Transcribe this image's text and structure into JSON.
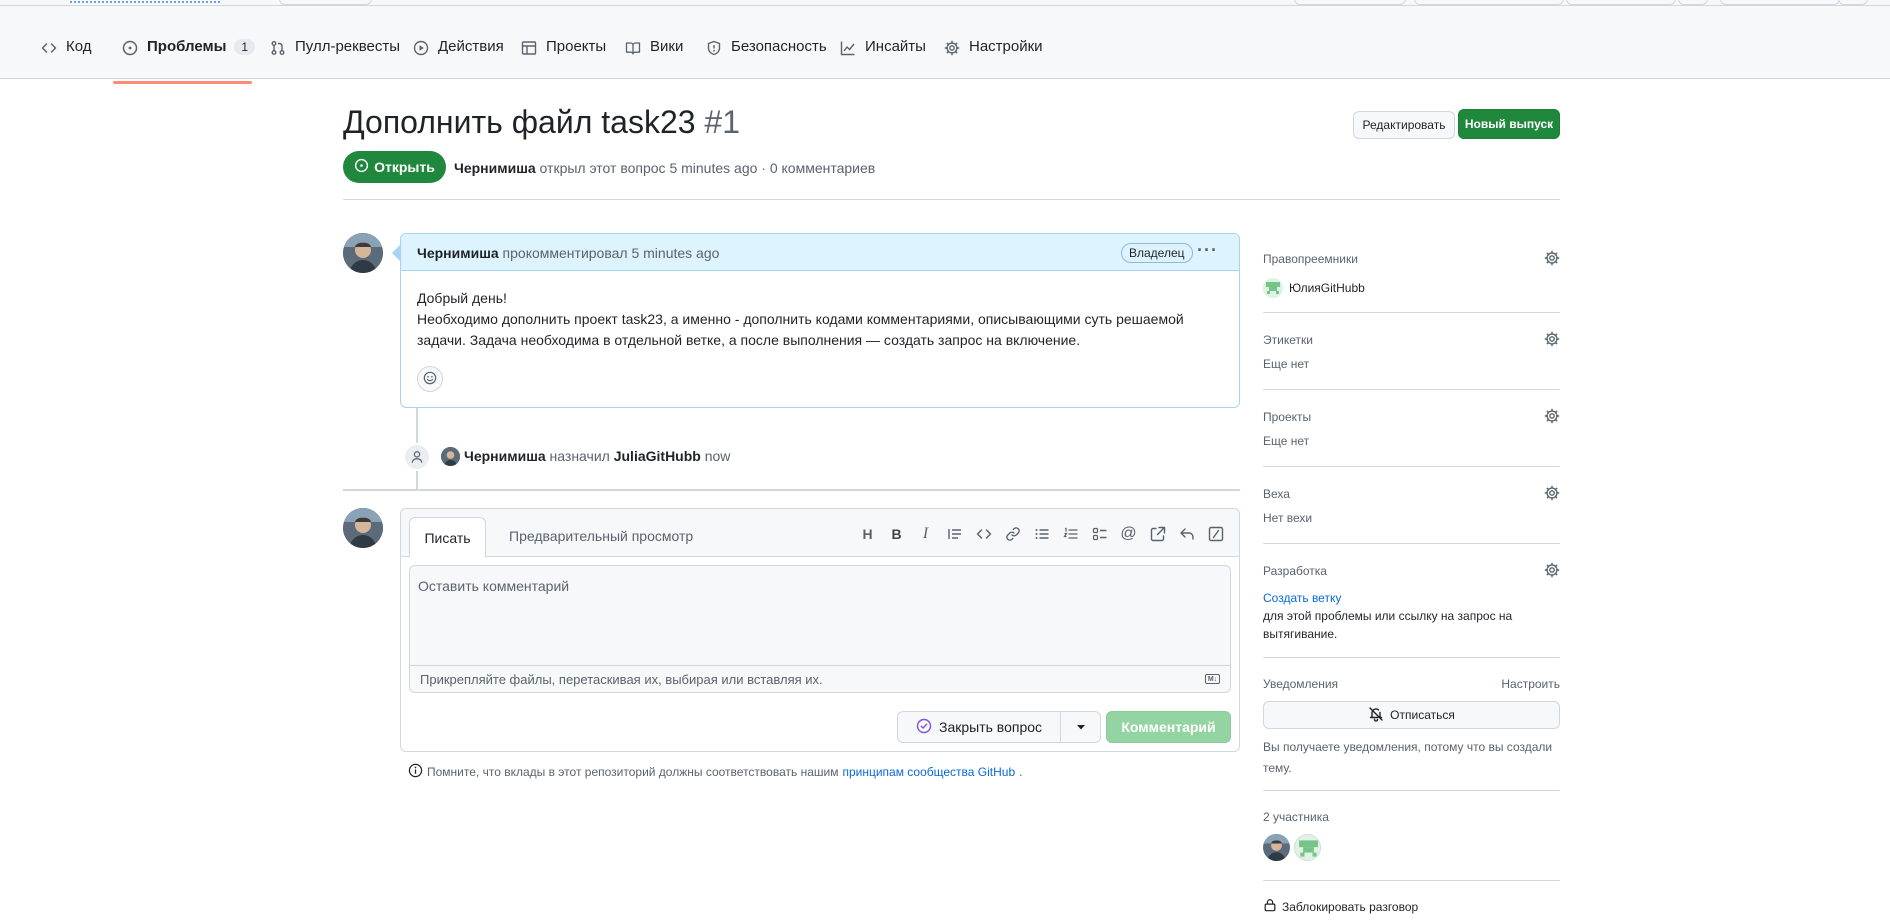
{
  "nav": {
    "tabs": [
      {
        "label": "Код",
        "icon": "code-icon"
      },
      {
        "label": "Проблемы",
        "icon": "issue-opened-icon",
        "count": "1"
      },
      {
        "label": "Пулл-реквесты",
        "icon": "git-pull-request-icon"
      },
      {
        "label": "Действия",
        "icon": "play-icon"
      },
      {
        "label": "Проекты",
        "icon": "table-icon"
      },
      {
        "label": "Вики",
        "icon": "book-icon"
      },
      {
        "label": "Безопасность",
        "icon": "shield-icon"
      },
      {
        "label": "Инсайты",
        "icon": "graph-icon"
      },
      {
        "label": "Настройки",
        "icon": "gear-icon"
      }
    ],
    "active": "Проблемы"
  },
  "issue": {
    "title": "Дополнить файл task23",
    "number": "#1",
    "state": "Открыть",
    "author": "Чернимиша",
    "meta_text": "открыл этот вопрос 5 minutes ago · 0 комментариев",
    "edit_label": "Редактировать",
    "new_label": "Новый выпуск"
  },
  "comment": {
    "author": "Чернимиша",
    "action": "прокомментировал 5 minutes ago",
    "badge": "Владелец",
    "body_line1": "Добрый день!",
    "body_line2": "Необходимо дополнить проект task23, а именно - дополнить кодами комментариями, описывающими суть решаемой задачи. Задача необходима в отдельной ветке, а после выполнения — создать запрос на включение."
  },
  "event": {
    "actor": "Чернимиша",
    "action": "назначил",
    "target": "JuliaGitHubb",
    "time": "now"
  },
  "editor": {
    "tab_write": "Писать",
    "tab_preview": "Предварительный просмотр",
    "placeholder": "Оставить комментарий",
    "attach_hint": "Прикрепляйте файлы, перетаскивая их, выбирая или вставляя их.",
    "close_label": "Закрыть вопрос",
    "comment_label": "Комментарий",
    "tools": [
      "heading-icon",
      "bold-icon",
      "italic-icon",
      "quote-icon",
      "code-icon",
      "link-icon",
      "unordered-list-icon",
      "ordered-list-icon",
      "tasklist-icon",
      "mention-icon",
      "cross-reference-icon",
      "reply-icon",
      "slash-icon"
    ]
  },
  "reminder": {
    "text": "Помните, что вклады в этот репозиторий должны соответствовать нашим",
    "link": "принципам сообщества GitHub",
    "end": "."
  },
  "sidebar": {
    "assignees_title": "Правопреемники",
    "assignee": "ЮлияGitHubb",
    "labels_title": "Этикетки",
    "labels_value": "Еще нет",
    "projects_title": "Проекты",
    "projects_value": "Еще нет",
    "milestone_title": "Веха",
    "milestone_value": "Нет вехи",
    "dev_title": "Разработка",
    "dev_link": "Создать ветку",
    "dev_text": "для этой проблемы или ссылку на запрос на вытягивание.",
    "notif_title": "Уведомления",
    "notif_customize": "Настроить",
    "unsubscribe": "Отписаться",
    "notif_text": "Вы получаете уведомления, потому что вы создали тему.",
    "participants_title": "2 участника",
    "lock": "Заблокировать разговор"
  },
  "colors": {
    "accent_green": "#1f883d",
    "link_blue": "#0969da",
    "nav_underline": "#fd8c73",
    "comment_header": "#ddf4ff"
  }
}
